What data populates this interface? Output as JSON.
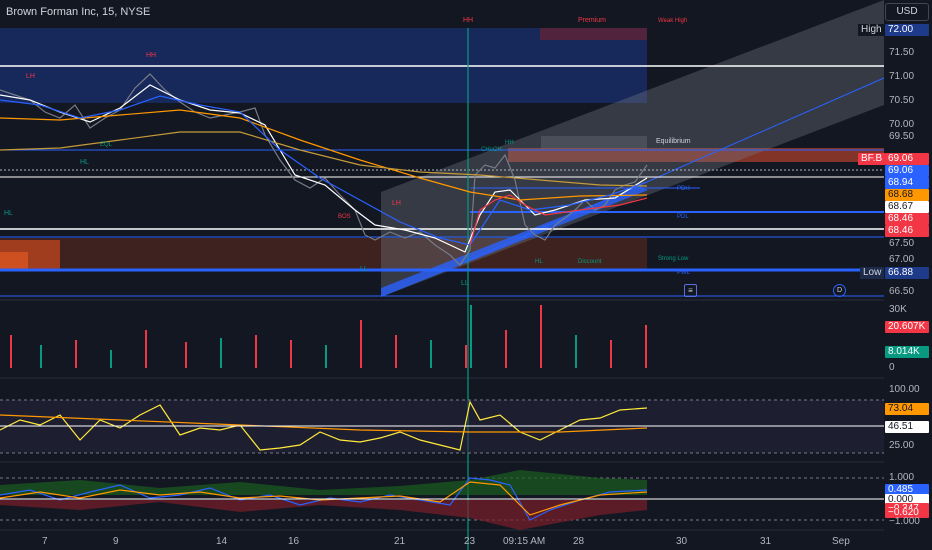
{
  "header": {
    "symbol_title": "Brown Forman Inc, 15, NYSE",
    "currency": "USD"
  },
  "price_axis": {
    "ticks": [
      "71.50",
      "71.00",
      "70.50",
      "70.00",
      "69.50",
      "67.50",
      "67.00",
      "66.50"
    ]
  },
  "price_tags": {
    "high_label": "High",
    "high_value": "72.00",
    "bfb_label": "BF.B",
    "bfb_value": "69.06",
    "blue_value_1": "69.06",
    "blue_value_2": "68.94",
    "orange_value": "68.68",
    "white_value": "68.67",
    "red_value_1": "68.46",
    "red_value_2": "68.46",
    "low_label": "Low",
    "low_value": "66.88"
  },
  "volume_axis": {
    "top_tick": "30K",
    "zero_tick": "0",
    "tag_red": "20.607K",
    "tag_green": "8.014K"
  },
  "rsi_axis": {
    "top_tick": "100.00",
    "bottom_tick": "25.00",
    "tag_orange": "73.04",
    "tag_white": "46.51"
  },
  "osc_axis": {
    "top_tick": "1.000",
    "bottom_tick": "−1.000",
    "tag_blue": "0.485",
    "tag_white": "0.000",
    "tag_red_1": "−0.347",
    "tag_red_2": "−0.620"
  },
  "time_axis": {
    "ticks": [
      "7",
      "9",
      "14",
      "16",
      "21",
      "23",
      "09:15 AM",
      "28",
      "30",
      "31",
      "Sep"
    ]
  },
  "annotations": {
    "hh_top": "HH",
    "premium": "Premium",
    "weak_high": "Weak High",
    "equilibrium": "Equilibrium",
    "discount": "Discount",
    "strong_low": "Strong Low",
    "pdh": "PDH",
    "pdl": "PDL",
    "pwl": "PWL",
    "hh_left": "HH",
    "lh_left": "LH",
    "hl_left": "HL",
    "hl_far_left": "HL",
    "lh_mid": "LH",
    "ll_mid": "LL",
    "ll_bottom": "LL",
    "bos": "BOS",
    "choch": "CHoCH",
    "eql": "EQL",
    "hl_right": "HL",
    "hh_right": "HH"
  },
  "icons": {
    "box_glyph": "≡",
    "circle_glyph": "D"
  },
  "colors": {
    "background": "#131722",
    "blue": "#2962ff",
    "red": "#f23645",
    "orange": "#ff9800",
    "green": "#089981",
    "white": "#ffffff"
  }
}
